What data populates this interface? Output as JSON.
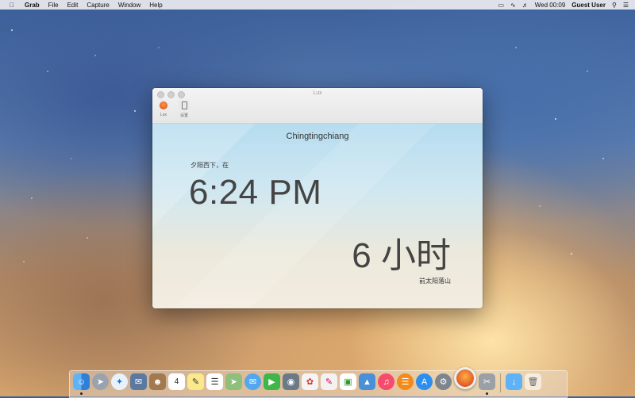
{
  "menubar": {
    "app": "Grab",
    "items": [
      "File",
      "Edit",
      "Capture",
      "Window",
      "Help"
    ],
    "clock": "Wed 00:09",
    "user": "Guest User"
  },
  "window": {
    "title": "Lux",
    "toolbar": [
      {
        "label": "Lux",
        "icon": "lux-sun-icon"
      },
      {
        "label": "设置",
        "icon": "settings-phone-icon"
      }
    ],
    "location": "Chingtingchiang",
    "sunset_prefix": "夕阳西下，在",
    "time": "6:24 PM",
    "hours": "6 小时",
    "until_text": "前太阳落山"
  },
  "dock": {
    "calendar_day": "4"
  },
  "colors": {
    "accent": "#e2541f",
    "window_bg": "#f6f4f0"
  }
}
